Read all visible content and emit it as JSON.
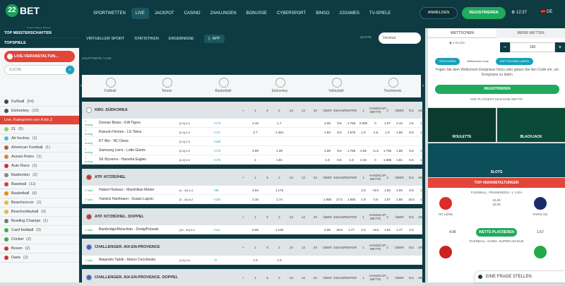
{
  "brand": {
    "logo_mark": "22",
    "logo_text": "BET",
    "tagline": "Spiel Online Sicher"
  },
  "nav": [
    "SPORTWETTEN",
    "LIVE",
    "JACKPOT",
    "CASINO",
    "ZAHLUNGEN",
    "BONUSSE",
    "CYBERSPORT",
    "BINGO",
    "22GAMES",
    "TV-SPIELE"
  ],
  "header": {
    "login": "ANMELDEN",
    "register": "REGISTRIEREN",
    "time": "12:37",
    "lang": "DE"
  },
  "left": {
    "top_championships": "TOP MEISTERSCHAFTEN",
    "top_games": "TOPSPIELE",
    "live_events": "LIVE-VERANSTALTUN...",
    "search_placeholder": "SUCHE",
    "items": [
      {
        "label": "Fußball",
        "count": "(54)",
        "color": "#444"
      },
      {
        "label": "Eishockey",
        "count": "(10)",
        "color": "#555"
      },
      {
        "label": "Live, Kategorien von A bis Z",
        "count": "",
        "color": "#e2463a"
      },
      {
        "label": "21",
        "count": "(5)",
        "color": "#9c6"
      },
      {
        "label": "Air hockey",
        "count": "(1)",
        "color": "#5bc"
      },
      {
        "label": "American Football",
        "count": "(1)",
        "color": "#a63"
      },
      {
        "label": "Aussie Rules",
        "count": "(1)",
        "color": "#c84"
      },
      {
        "label": "Auto Race",
        "count": "(1)",
        "color": "#c33"
      },
      {
        "label": "Badminton",
        "count": "(2)",
        "color": "#888"
      },
      {
        "label": "Baseball",
        "count": "(11)",
        "color": "#c44"
      },
      {
        "label": "Basketball",
        "count": "(6)",
        "color": "#e80"
      },
      {
        "label": "Beachsoccer",
        "count": "(1)",
        "color": "#db4"
      },
      {
        "label": "Beachvolleyball",
        "count": "(3)",
        "color": "#db4"
      },
      {
        "label": "Bowling Champs",
        "count": "(1)",
        "color": "#777"
      },
      {
        "label": "Card football",
        "count": "(3)",
        "color": "#4a4"
      },
      {
        "label": "Cricket",
        "count": "(2)",
        "color": "#4a4"
      },
      {
        "label": "Boxen",
        "count": "(2)",
        "color": "#c33"
      },
      {
        "label": "Darts",
        "count": "(2)",
        "color": "#c33"
      }
    ]
  },
  "center": {
    "sub": [
      "VIRTUELLER SPORT",
      "STATISTIKEN",
      "ERGEBNISSE"
    ],
    "app": "APP",
    "quote_label": "QUOTE",
    "quote_value": "Decimal",
    "breadcrumb": "HAUPTSEITE  /  LIVE",
    "sports": [
      "Fußball",
      "Tennis",
      "Basketball",
      "Eishockey",
      "Volleyball",
      "Tischtennis"
    ],
    "columns": [
      "+",
      "1",
      "X",
      "2",
      "1X",
      "12",
      "2X",
      "ÜBER",
      "GESAMT",
      "UNTER",
      "1",
      "HANDICAP-WETTE",
      "2",
      "ÜBER",
      "IG1",
      "UNTER"
    ],
    "leagues": [
      {
        "name": "KBO. SÜDKOREA",
        "flag": "#fff",
        "rows": [
          {
            "t": "1 Inning",
            "m": "Doosan Bears - KIA Tigers",
            "s": "[0-0] 0-0",
            "more": "+173",
            "o": [
              "2.15",
              "",
              "1.7",
              "",
              "",
              "",
              "2.06",
              "9.5",
              "1.765",
              "2.055",
              "0",
              "1.67",
              "2.12",
              "4.5",
              "1.69"
            ]
          },
          {
            "t": "1 Inning",
            "m": "Kiwoom Heroes - LG Twins",
            "s": "[0-0] 0-0",
            "more": "+171",
            "o": [
              "2.7",
              "",
              "1.464",
              "",
              "",
              "",
              "1.83",
              "8.5",
              "1.975",
              "1.9",
              "-1.5",
              "1.9",
              "1.85",
              "5.5",
              "1.91"
            ]
          },
          {
            "t": "1 Inning",
            "m": "KT Wiz - NC Dinos",
            "s": "[2-0] 2-0",
            "more": "+168",
            "o": [
              "",
              "",
              "",
              "",
              "",
              "",
              "",
              "",
              "",
              "",
              "",
              "",
              "",
              "",
              ""
            ]
          },
          {
            "t": "1 Inning",
            "m": "Samsung Lions - Lotte Giants",
            "s": "[0-0] 0-0",
            "more": "+173",
            "o": [
              "2.99",
              "",
              "1.39",
              "",
              "",
              "",
              "2.06",
              "9.5",
              "1.765",
              "2.06",
              "+1.5",
              "1.765",
              "1.85",
              "5.5",
              "1.91"
            ]
          },
          {
            "t": "1 Inning",
            "m": "SK Wyverns - Hanwha Eagles",
            "s": "[0-0] 0-0",
            "more": "+170",
            "o": [
              "2",
              "",
              "1.81",
              "",
              "",
              "",
              "1.9",
              "8.5",
              "1.9",
              "2.16",
              "0",
              "1.696",
              "1.81",
              "5.5",
              "1.97"
            ]
          }
        ]
      },
      {
        "name": "ATP. KITZBÜHEL",
        "flag": "#c33",
        "rows": [
          {
            "t": "2 Satz",
            "m": "Hubert Hurkacz - Maximilian Marter",
            "s": "[4 - 40] 1-6",
            "more": "+88",
            "o": [
              "4.94",
              "",
              "1.175",
              "",
              "",
              "",
              "",
              "",
              "",
              "2.5",
              "+6.5",
              "1.53",
              "1.93",
              "5.5",
              "1.88"
            ]
          },
          {
            "t": "2 Satz",
            "m": "Yannick Hanfmann - Dusan Lajovic",
            "s": "[0 - 30] 6-2",
            "more": "+100",
            "o": [
              "2.15",
              "",
              "1.74",
              "",
              "",
              "",
              "1.955",
              "27.5",
              "1.845",
              "1.9",
              "-2.5",
              "1.87",
              "1.88",
              "15.5",
              "1.88"
            ]
          }
        ]
      },
      {
        "name": "ATP. KITZBÜHEL. DOPPEL",
        "flag": "#c33",
        "rows": [
          {
            "t": "1 Satz",
            "m": "Bambridge/Mclachlan - Dodig/Polasek",
            "s": "[15 - 30] 0-5",
            "more": "+112",
            "o": [
              "6.05",
              "",
              "1.125",
              "",
              "",
              "",
              "2.05",
              "18.5",
              "1.77",
              "1.9",
              "+5.5",
              "1.82",
              "1.77",
              "1.9",
              ""
            ]
          }
        ]
      },
      {
        "name": "CHALLENGER. AIX-EN-PROVENCE",
        "flag": "#36c",
        "rows": [
          {
            "t": "1 Satz",
            "m": "Alejandro Tabilo - Marco Cecchinato",
            "s": "(0-0) 0-0",
            "more": "+5",
            "o": [
              "1.9",
              "",
              "1.9",
              "",
              "",
              "",
              "",
              "",
              "",
              "",
              "",
              "",
              "",
              "",
              ""
            ]
          }
        ]
      },
      {
        "name": "CHALLENGER. AIX-EN-PROVENCE. DOPPEL",
        "flag": "#36c",
        "rows": []
      }
    ]
  },
  "right": {
    "tab_slip": "WETTSCHEIN",
    "tab_mybets": "MEINE WETTEN",
    "one_click": "1-KLICK",
    "pills": [
      "SPEICHERN",
      "Wettschein-Code",
      "WETTSCHEIN LADEN"
    ],
    "stake": "100",
    "message": "Fügen Sie dem Wettschein Ereignisse hinzu oder geben Sie den Code ein, um Ereignisse zu laden",
    "register": "REGISTRIEREN",
    "how_to": "WIE PLATZIERT MAN EINE WETTE",
    "games": [
      "ROULETTE",
      "BLACKJACK",
      "SLOTS"
    ],
    "events_header": "TOP-VERANSTALTUNGEN",
    "event1": {
      "league": "FUSSBALL. FRANKREICH. 1. LIGA",
      "home": "RC LENS",
      "away": "PARIS SG",
      "date": "10.09",
      "time": "22:00",
      "o1": "4.96",
      "mid": "WETTE PLATZIEREN",
      "o2": "1.67"
    },
    "event2": {
      "league": "FUSSBALL. CHINA. SUPER LEAGUE"
    }
  },
  "ask": "EINE FRAGE STELLEN"
}
